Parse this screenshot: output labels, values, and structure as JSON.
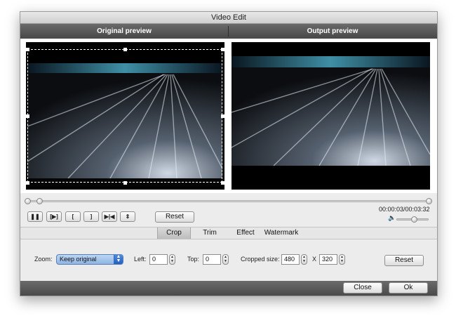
{
  "window": {
    "title": "Video Edit"
  },
  "preview": {
    "original_label": "Original preview",
    "output_label": "Output preview"
  },
  "playback": {
    "timecode": "00:00:03/00:03:32",
    "seek_fraction": 0.016,
    "volume_fraction": 0.55,
    "buttons": {
      "pause": "❚❚",
      "step": "[▶]",
      "mark_in": "[",
      "mark_out": "]",
      "split": "▶|◀",
      "flip": "⇕"
    },
    "reset_label": "Reset"
  },
  "tabs": [
    {
      "label": "Crop",
      "active": true
    },
    {
      "label": "Trim",
      "active": false
    },
    {
      "label": "Effect",
      "active": false
    },
    {
      "label": "Watermark",
      "active": false
    }
  ],
  "crop": {
    "zoom_label": "Zoom:",
    "zoom_value": "Keep original",
    "left_label": "Left:",
    "left_value": "0",
    "top_label": "Top:",
    "top_value": "0",
    "size_label": "Cropped size:",
    "width_value": "480",
    "times_sign": "X",
    "height_value": "320",
    "reset_label": "Reset"
  },
  "footer": {
    "close_label": "Close",
    "ok_label": "Ok"
  },
  "icons": {
    "up_arrow": "▲",
    "down_arrow": "▼",
    "speaker": "🔈"
  },
  "colors": {
    "header_bg": "#555555",
    "select_blue": "#8fb4e4"
  }
}
